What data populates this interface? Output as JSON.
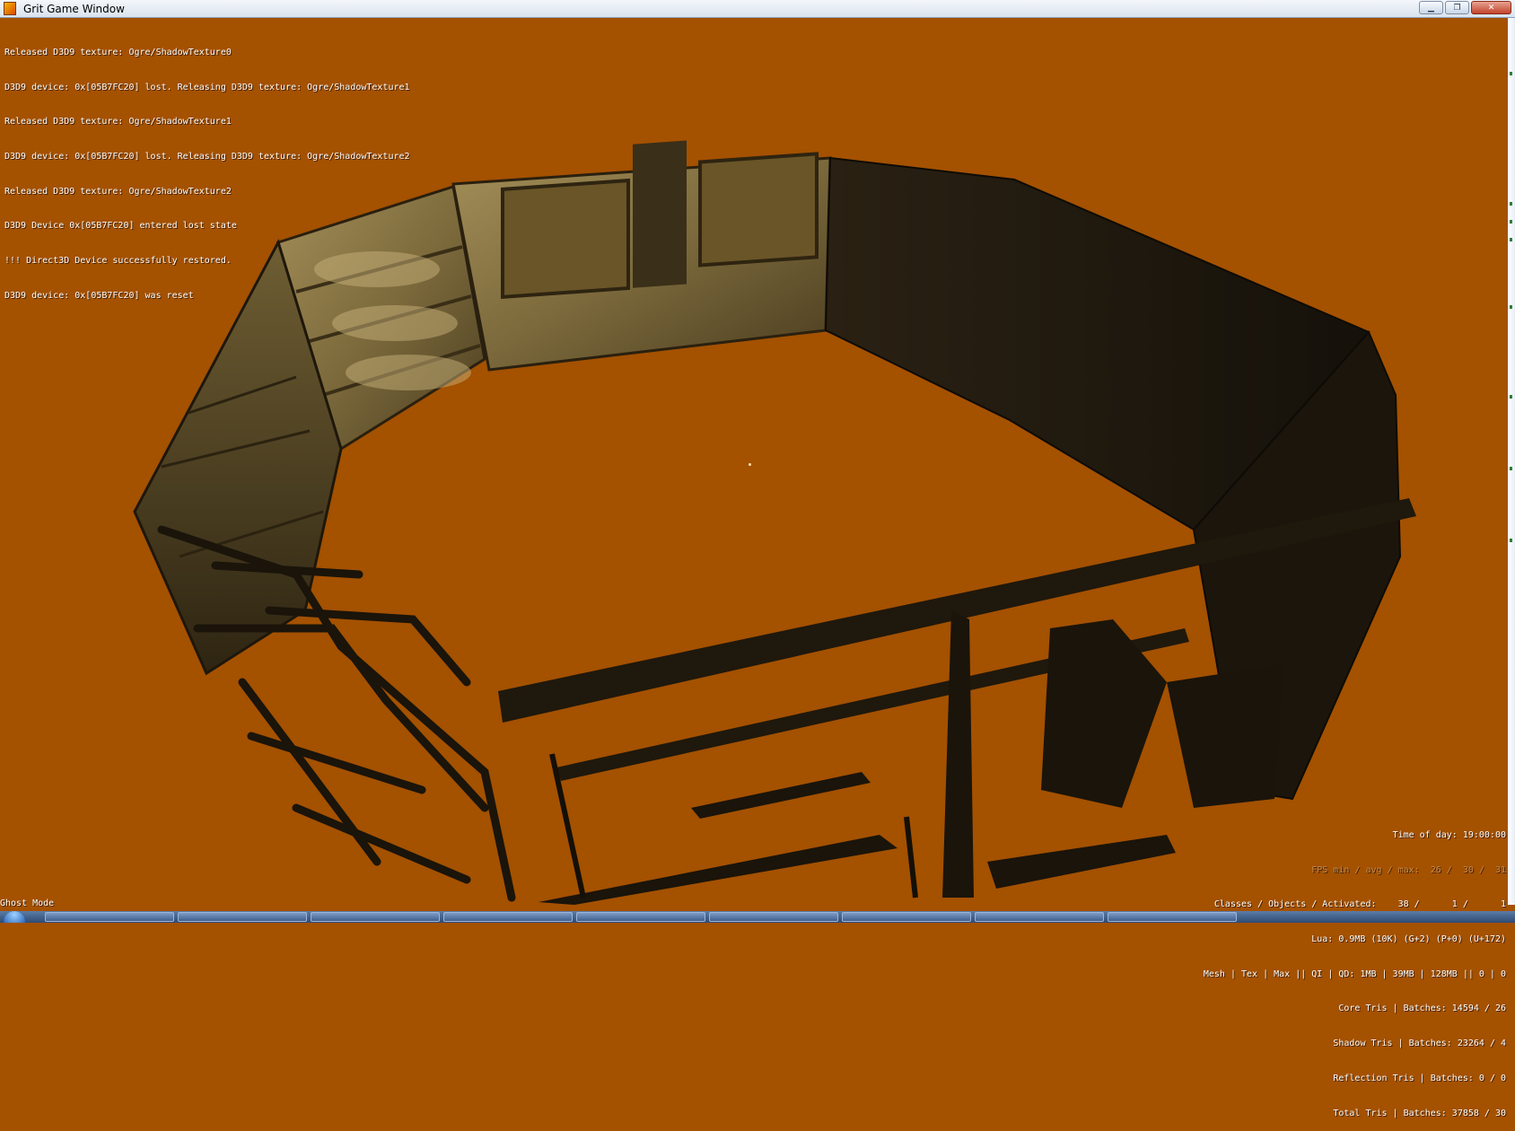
{
  "window": {
    "title": "Grit Game Window",
    "minimize_symbol": "▁",
    "maximize_symbol": "❐",
    "close_symbol": "✕"
  },
  "console_lines": [
    "Released D3D9 texture: Ogre/ShadowTexture0",
    "D3D9 device: 0x[05B7FC20] lost. Releasing D3D9 texture: Ogre/ShadowTexture1",
    "Released D3D9 texture: Ogre/ShadowTexture1",
    "D3D9 device: 0x[05B7FC20] lost. Releasing D3D9 texture: Ogre/ShadowTexture2",
    "Released D3D9 texture: Ogre/ShadowTexture2",
    "D3D9 Device 0x[05B7FC20] entered lost state",
    "!!! Direct3D Device successfully restored.",
    "D3D9 device: 0x[05B7FC20] was reset"
  ],
  "stats": {
    "time_of_day": "Time of day: 19:00:00",
    "fps": "FPS min / avg / max:  26 /  30 /  31",
    "classes_objects": "Classes / Objects / Activated:    38 /      1 /      1",
    "lua": "Lua: 0.9MB (10K) (G+2) (P+0) (U+172)",
    "mesh_tex": "Mesh | Tex | Max || QI | QD: 1MB | 39MB | 128MB || 0 | 0",
    "core_tris": "Core Tris | Batches: 14594 / 26",
    "shadow_tris": "Shadow Tris | Batches: 23264 / 4",
    "reflection_tris": "Reflection Tris | Batches: 0 / 0",
    "total_tris": "Total Tris | Batches: 37858 / 30"
  },
  "mode_label": "Ghost Mode",
  "colors": {
    "background": "#a45100",
    "wall_light": "#8a7644",
    "wall_dark": "#1e170c"
  },
  "icons": {
    "app": "grit-app-icon",
    "start": "windows-start-orb"
  }
}
